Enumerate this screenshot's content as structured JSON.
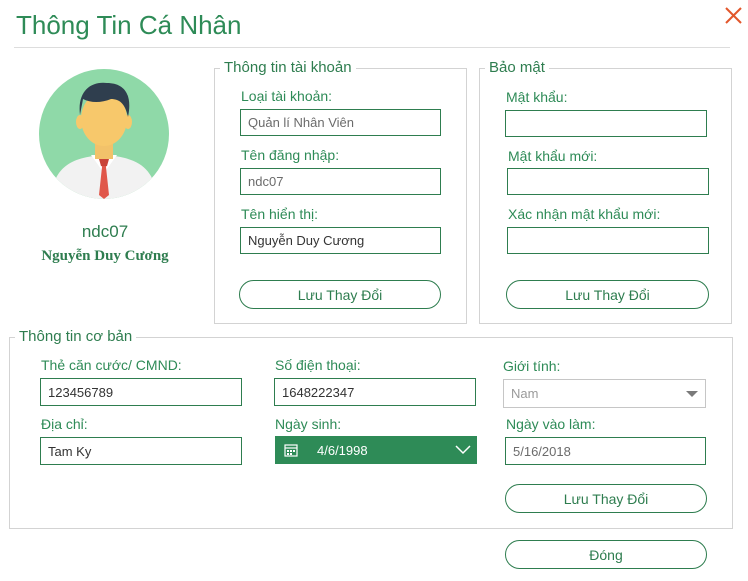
{
  "window": {
    "title": "Thông Tin Cá Nhân",
    "close_icon": "close-icon"
  },
  "profile": {
    "username": "ndc07",
    "full_name": "Nguyễn Duy Cương"
  },
  "account": {
    "legend": "Thông tin tài khoản",
    "type_label": "Loại tài khoản:",
    "type_value": "Quản lí Nhân Viên",
    "login_label": "Tên đăng nhập:",
    "login_value": "ndc07",
    "display_label": "Tên hiển thị:",
    "display_value": "Nguyễn Duy Cương",
    "save_label": "Lưu Thay Đổi"
  },
  "security": {
    "legend": "Bảo mật",
    "password_label": "Mật khẩu:",
    "password_value": "",
    "new_password_label": "Mật khẩu mới:",
    "new_password_value": "",
    "confirm_label": "Xác nhận mật khẩu mới:",
    "confirm_value": "",
    "save_label": "Lưu Thay Đổi"
  },
  "basic": {
    "legend": "Thông tin cơ bản",
    "id_label": "Thẻ căn cước/ CMND:",
    "id_value": "123456789",
    "phone_label": "Số điện thoại:",
    "phone_value": "1648222347",
    "gender_label": "Giới tính:",
    "gender_value": "Nam",
    "address_label": "Địa chỉ:",
    "address_value": "Tam Ky",
    "dob_label": "Ngày sinh:",
    "dob_value": "4/6/1998",
    "start_label": "Ngày vào làm:",
    "start_value": "5/16/2018",
    "save_label": "Lưu Thay Đổi"
  },
  "footer": {
    "close_label": "Đóng"
  },
  "colors": {
    "accent": "#2e8b57",
    "close_icon": "#e2572b",
    "avatar_bg": "#8fd9a8"
  }
}
